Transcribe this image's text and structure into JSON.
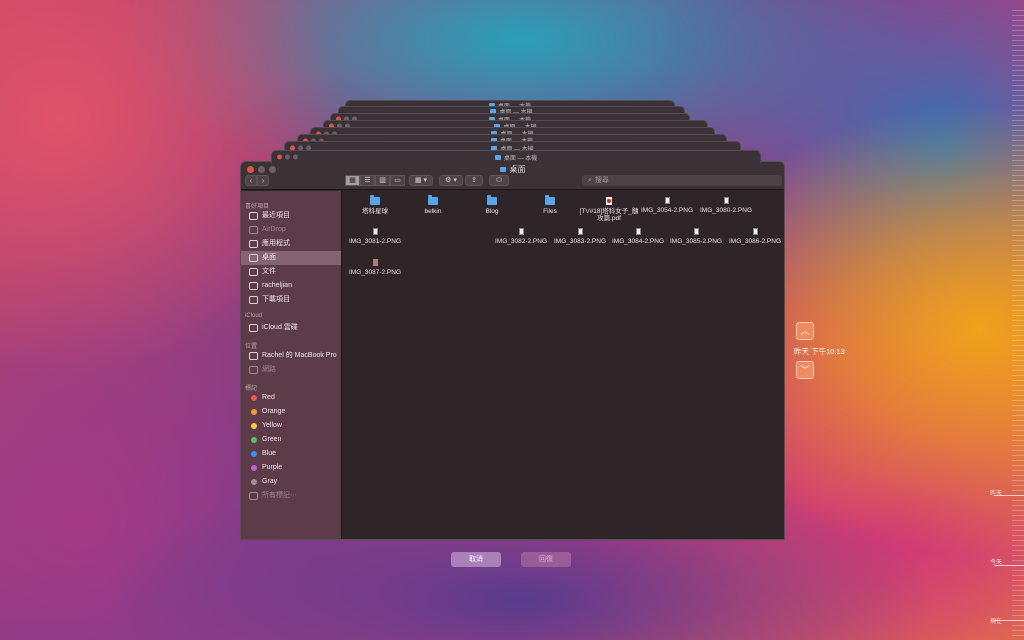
{
  "window": {
    "title": "桌面",
    "back_title": "桌面 — 本機",
    "search_placeholder": "搜尋"
  },
  "toolbar": {
    "back_icon": "chevron-left-icon",
    "forward_icon": "chevron-right-icon",
    "view_modes": [
      "icon-view-icon",
      "list-view-icon",
      "column-view-icon",
      "gallery-view-icon"
    ]
  },
  "sidebar": {
    "favorites_header": "喜好項目",
    "favorites": [
      {
        "label": "最近項目",
        "icon": "clock-icon",
        "dim": false,
        "selected": false
      },
      {
        "label": "AirDrop",
        "icon": "airdrop-icon",
        "dim": true,
        "selected": false
      },
      {
        "label": "應用程式",
        "icon": "applications-icon",
        "dim": false,
        "selected": false
      },
      {
        "label": "桌面",
        "icon": "desktop-icon",
        "dim": false,
        "selected": true
      },
      {
        "label": "文件",
        "icon": "document-icon",
        "dim": false,
        "selected": false
      },
      {
        "label": "racheljian",
        "icon": "home-icon",
        "dim": false,
        "selected": false
      },
      {
        "label": "下載項目",
        "icon": "download-icon",
        "dim": false,
        "selected": false
      }
    ],
    "icloud_header": "iCloud",
    "icloud": [
      {
        "label": "iCloud 雲碟",
        "icon": "cloud-icon"
      }
    ],
    "locations_header": "位置",
    "locations": [
      {
        "label": "Rachel 的 MacBook Pro",
        "icon": "laptop-icon",
        "dim": false
      },
      {
        "label": "網路",
        "icon": "network-icon",
        "dim": true
      }
    ],
    "tags_header": "標記",
    "tags": [
      {
        "label": "Red",
        "color": "#e8584f"
      },
      {
        "label": "Orange",
        "color": "#f29a3a"
      },
      {
        "label": "Yellow",
        "color": "#f3cd3c"
      },
      {
        "label": "Green",
        "color": "#5bc25a"
      },
      {
        "label": "Blue",
        "color": "#3a8ff0"
      },
      {
        "label": "Purple",
        "color": "#b566d9"
      },
      {
        "label": "Gray",
        "color": "#9a9498"
      }
    ],
    "all_tags": "所有標記⋯"
  },
  "files": [
    {
      "name": "塔科星球",
      "type": "folder"
    },
    {
      "name": "belkin",
      "type": "folder"
    },
    {
      "name": "Blog",
      "type": "folder"
    },
    {
      "name": "Files",
      "type": "folder"
    },
    {
      "name": "[TV#18]塔科女子_髓攻篇.pdf",
      "type": "pdf"
    },
    {
      "name": "IMG_3054-2.PNG",
      "type": "png"
    },
    {
      "name": "IMG_3080-2.PNG",
      "type": "png"
    },
    {
      "name": "IMG_3081-2.PNG",
      "type": "png"
    },
    {
      "name": "IMG_3082-2.PNG",
      "type": "png"
    },
    {
      "name": "IMG_3083-2.PNG",
      "type": "png"
    },
    {
      "name": "IMG_3084-2.PNG",
      "type": "png"
    },
    {
      "name": "IMG_3085-2.PNG",
      "type": "png"
    },
    {
      "name": "IMG_3086-2.PNG",
      "type": "png"
    },
    {
      "name": "IMG_3087-2.PNG",
      "type": "png-red"
    }
  ],
  "time_machine": {
    "up_icon": "chevron-up-icon",
    "down_icon": "chevron-down-icon",
    "current_time": "昨天 下午10:13",
    "timeline": [
      "昨天",
      "今天",
      "現在"
    ]
  },
  "buttons": {
    "cancel": "取消",
    "restore": "回復"
  },
  "colors": {
    "accent_button": "#a980b8",
    "time_arrow": "#f08a5f",
    "sidebar_bg": "#5e3b48",
    "content_bg": "#2d2528"
  }
}
